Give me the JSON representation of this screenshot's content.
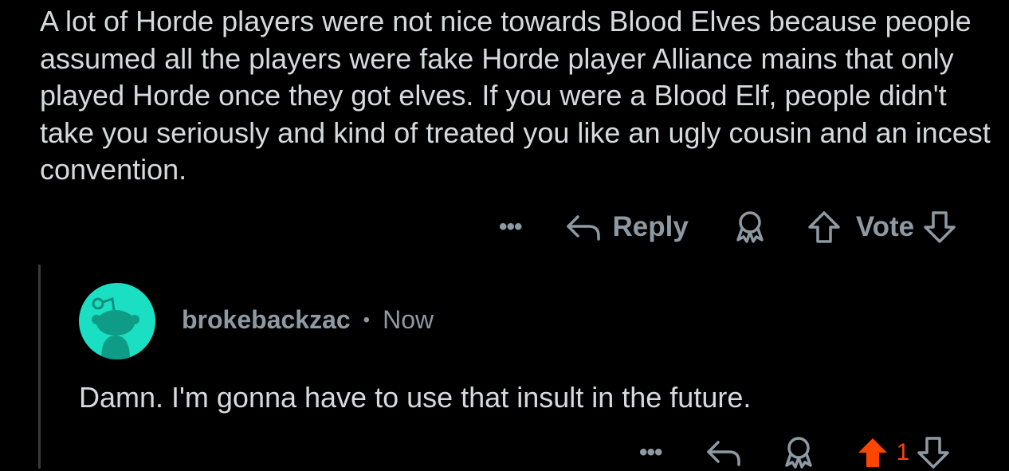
{
  "parent_comment": {
    "body": "A lot of Horde players were not nice towards Blood Elves because people assumed all the players were fake Horde player Alliance mains that only played Horde once they got elves. If you were a Blood Elf, people didn't take you seriously and kind of treated you like an ugly cousin and an incest convention.",
    "actions": {
      "more": "•••",
      "reply": "Reply",
      "vote": "Vote"
    }
  },
  "reply_comment": {
    "username": "brokebackzac",
    "separator": "•",
    "timestamp": "Now",
    "body": "Damn. I'm gonna have to use that insult in the future.",
    "actions": {
      "more": "•••",
      "score": "1"
    }
  },
  "colors": {
    "background": "#000000",
    "text": "#d7dadc",
    "muted": "#8e9aa3",
    "upvote_active": "#ff4500",
    "avatar_bg": "#1bdfc3"
  }
}
